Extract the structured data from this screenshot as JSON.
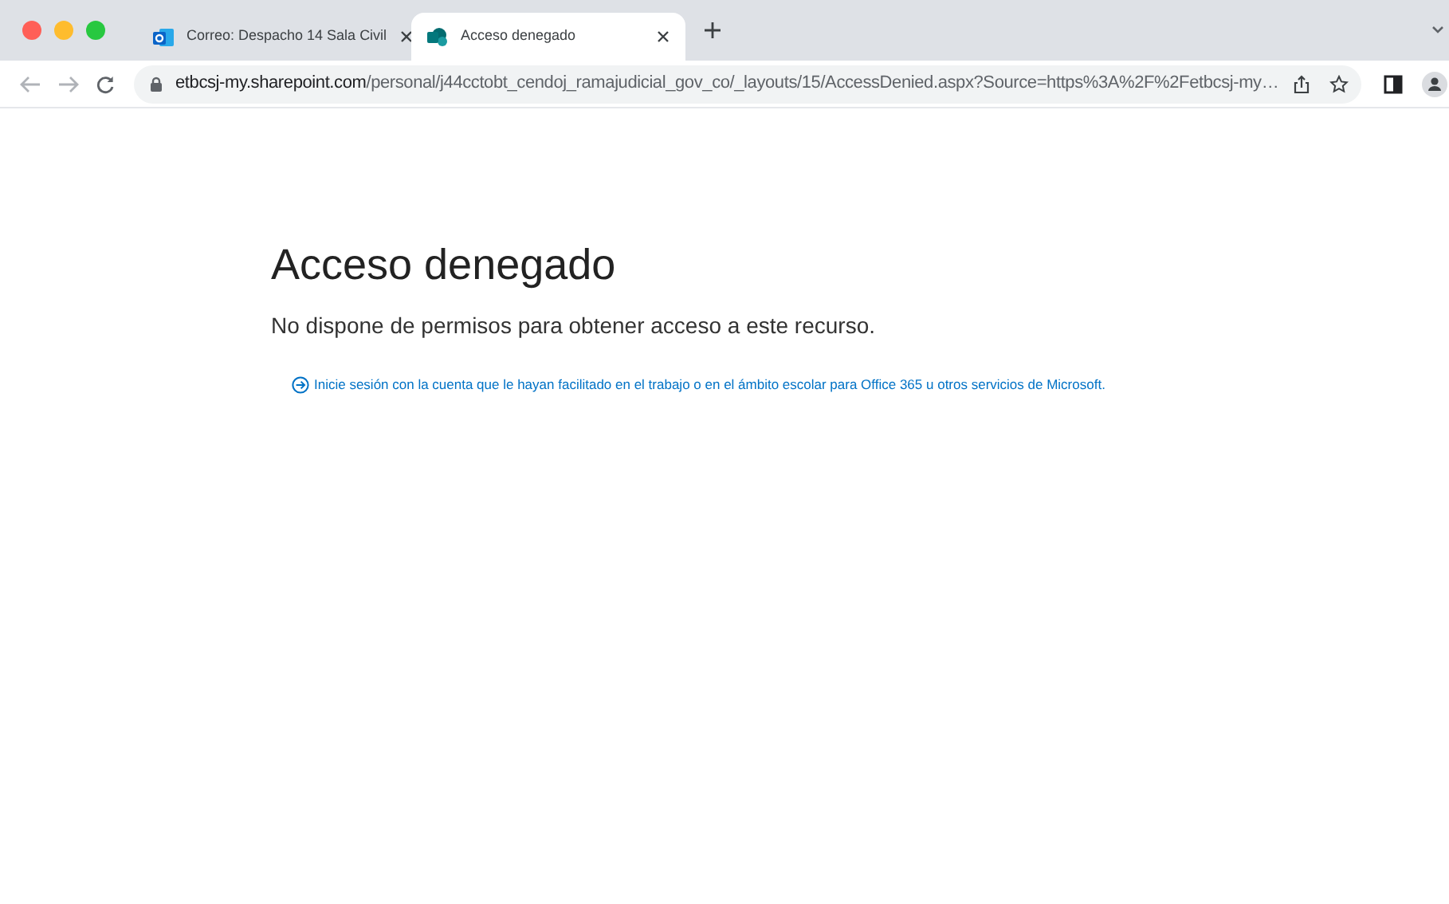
{
  "tabs": [
    {
      "title": "Correo: Despacho 14 Sala Civil",
      "selected": false,
      "kind": "mail"
    },
    {
      "title": "Acceso denegado",
      "selected": true,
      "kind": "sharepoint"
    }
  ],
  "address_bar": {
    "host": "etbcsj-my.sharepoint.com",
    "path": "/personal/j44cctobt_cendoj_ramajudicial_gov_co/_layouts/15/AccessDenied.aspx?Source=https%3A%2F%2Fetbcsj-my…"
  },
  "page": {
    "heading": "Acceso denegado",
    "message": "No dispone de permisos para obtener acceso a este recurso.",
    "sign_in_link": "Inicie sesión con la cuenta que le hayan facilitado en el trabajo o en el ámbito escolar para Office 365 u otros servicios de Microsoft."
  }
}
